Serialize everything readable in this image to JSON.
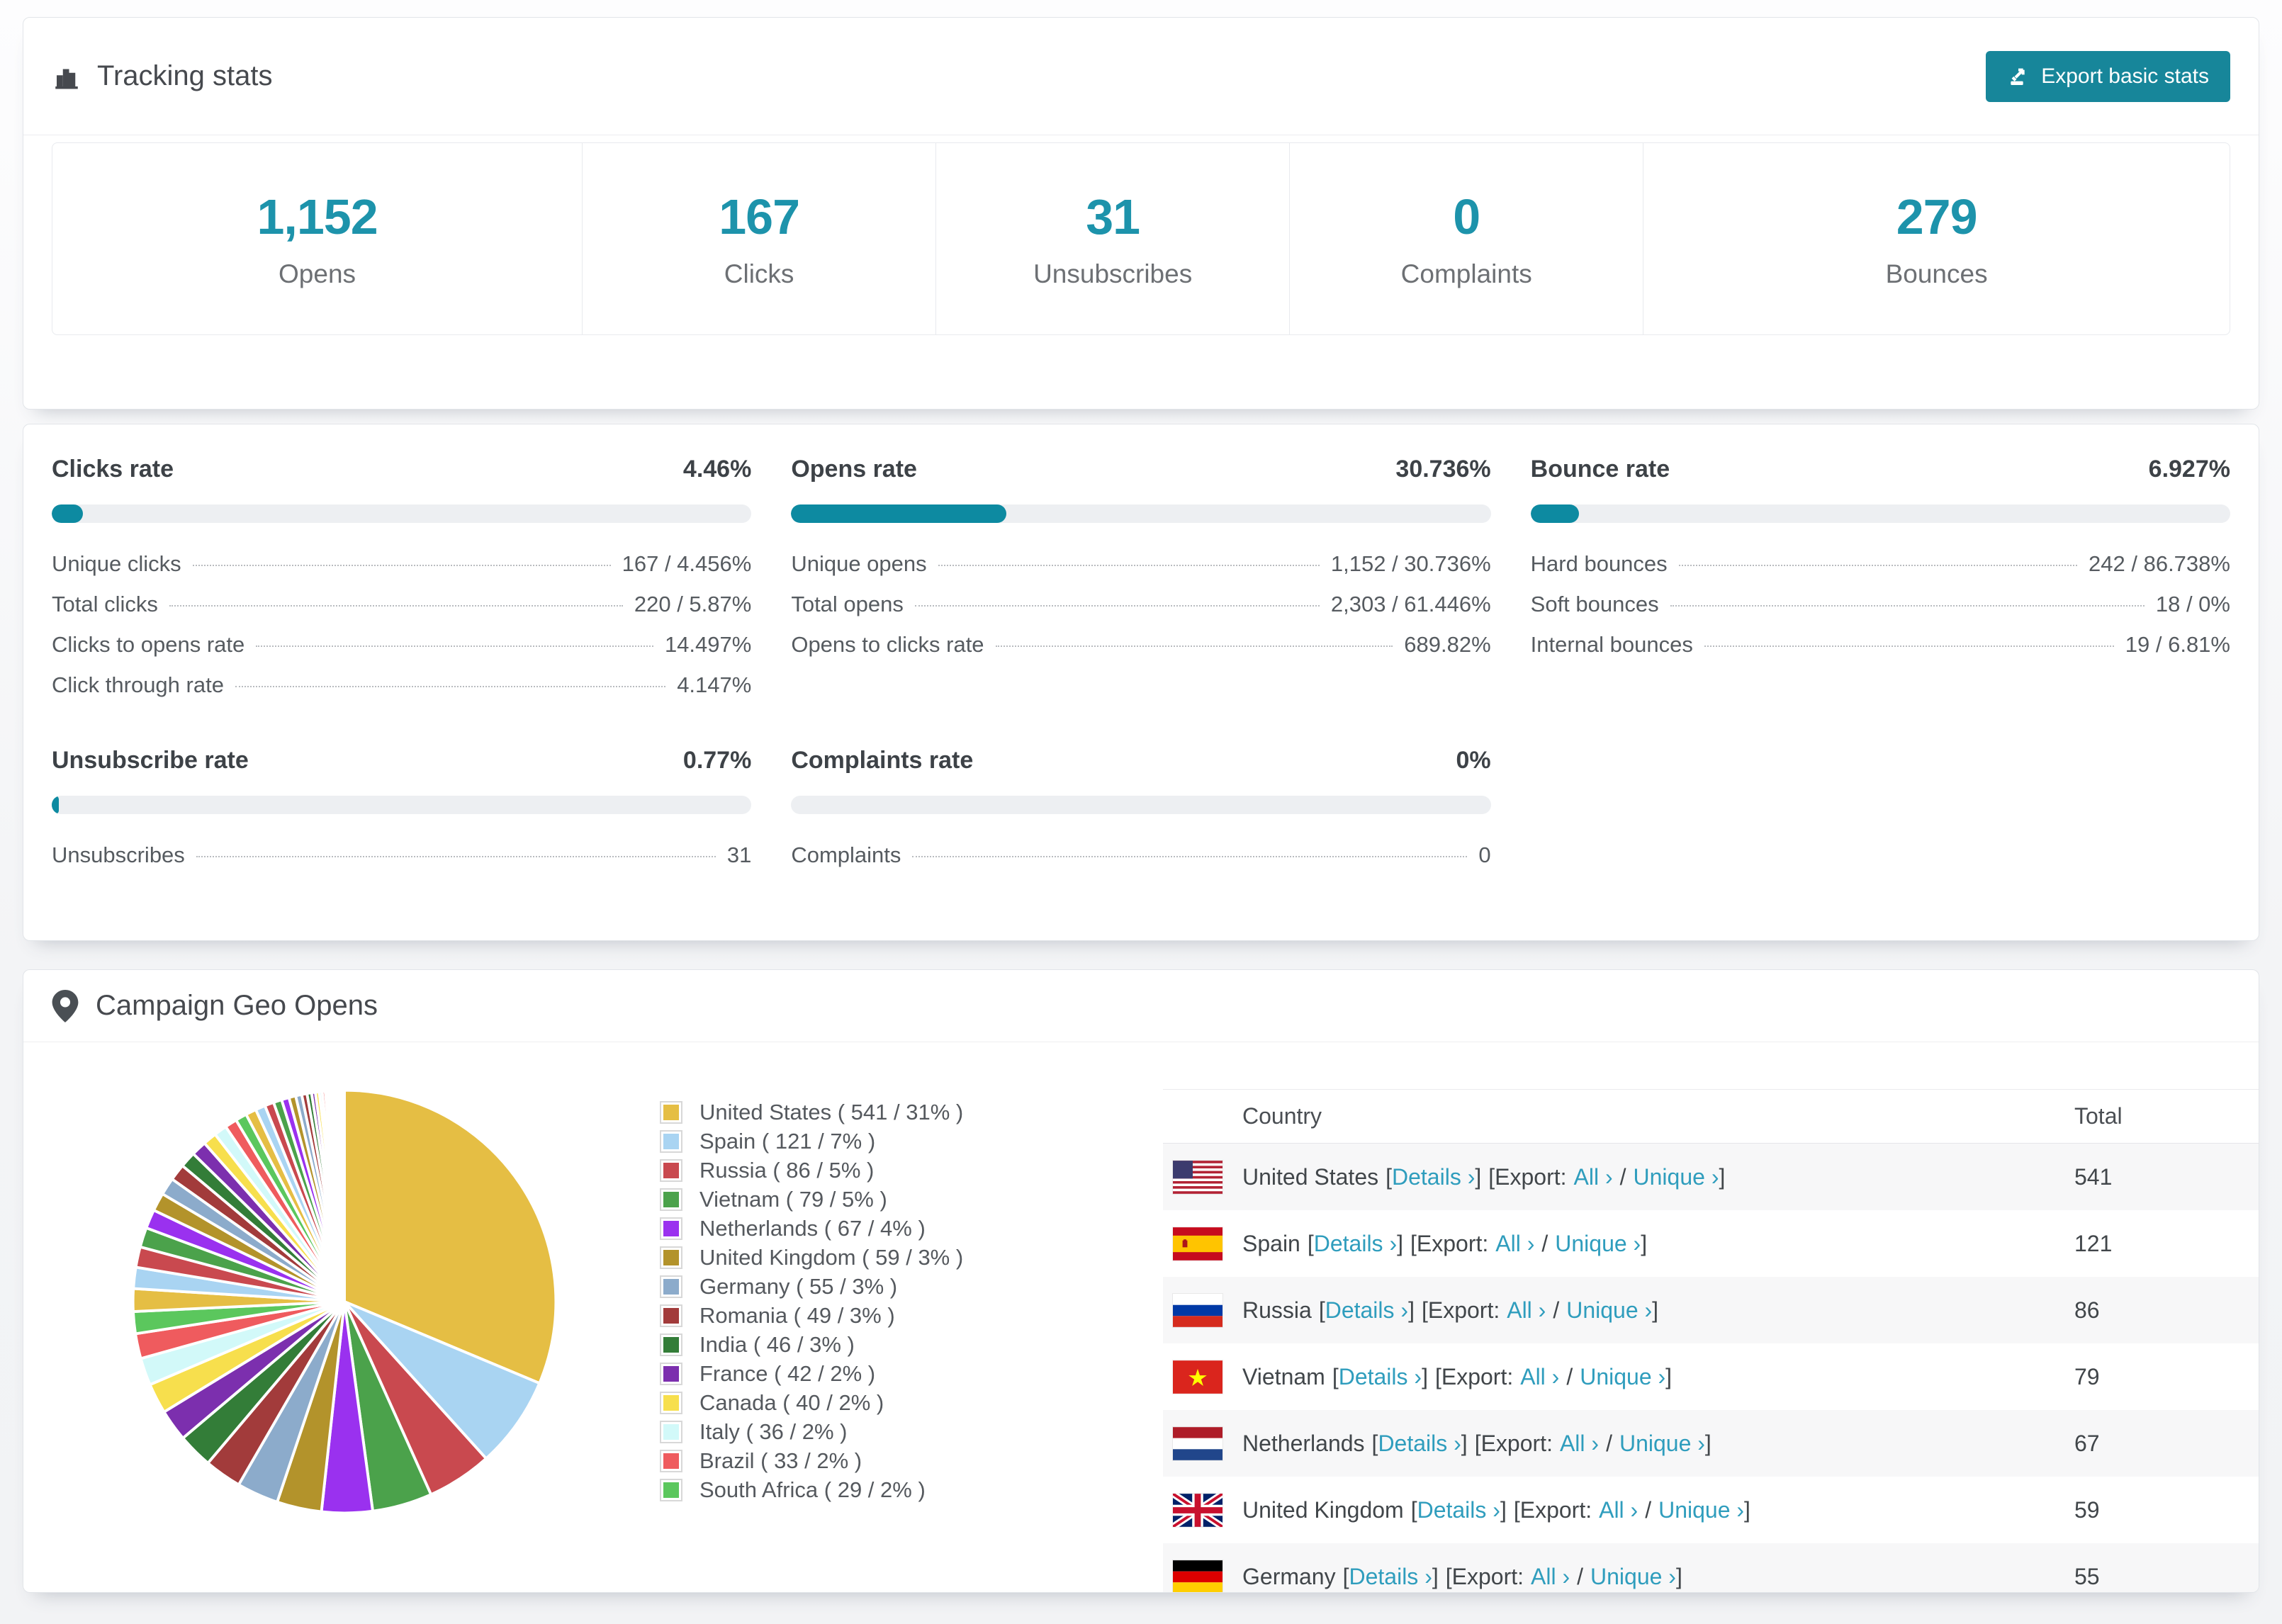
{
  "accent": "#17869a",
  "header": {
    "title": "Tracking stats",
    "export_label": "Export basic stats"
  },
  "summary": [
    {
      "value": "1,152",
      "label": "Opens"
    },
    {
      "value": "167",
      "label": "Clicks"
    },
    {
      "value": "31",
      "label": "Unsubscribes"
    },
    {
      "value": "0",
      "label": "Complaints"
    },
    {
      "value": "279",
      "label": "Bounces"
    }
  ],
  "rates": {
    "clicks": {
      "title": "Clicks rate",
      "value": "4.46%",
      "percent": 4.46,
      "rows": [
        {
          "label": "Unique clicks",
          "value": "167 / 4.456%"
        },
        {
          "label": "Total clicks",
          "value": "220 / 5.87%"
        },
        {
          "label": "Clicks to opens rate",
          "value": "14.497%"
        },
        {
          "label": "Click through rate",
          "value": "4.147%"
        }
      ]
    },
    "opens": {
      "title": "Opens rate",
      "value": "30.736%",
      "percent": 30.736,
      "rows": [
        {
          "label": "Unique opens",
          "value": "1,152 / 30.736%"
        },
        {
          "label": "Total opens",
          "value": "2,303 / 61.446%"
        },
        {
          "label": "Opens to clicks rate",
          "value": "689.82%"
        }
      ]
    },
    "bounce": {
      "title": "Bounce rate",
      "value": "6.927%",
      "percent": 6.927,
      "rows": [
        {
          "label": "Hard bounces",
          "value": "242 / 86.738%"
        },
        {
          "label": "Soft bounces",
          "value": "18 / 0%"
        },
        {
          "label": "Internal bounces",
          "value": "19 / 6.81%"
        }
      ]
    },
    "unsubscribe": {
      "title": "Unsubscribe rate",
      "value": "0.77%",
      "percent": 0.77,
      "rows": [
        {
          "label": "Unsubscribes",
          "value": "31"
        }
      ]
    },
    "complaints": {
      "title": "Complaints rate",
      "value": "0%",
      "percent": 0,
      "rows": [
        {
          "label": "Complaints",
          "value": "0"
        }
      ]
    }
  },
  "geo": {
    "title": "Campaign Geo Opens",
    "fmt": {
      "lb": "[",
      "rb": "]",
      "exp": "[Export:",
      "slash": "/"
    },
    "links": {
      "details": "Details ›",
      "all": "All ›",
      "unique": "Unique ›"
    },
    "table": {
      "headers": {
        "country": "Country",
        "total": "Total"
      },
      "rows": [
        {
          "country": "United States",
          "total": "541"
        },
        {
          "country": "Spain",
          "total": "121"
        },
        {
          "country": "Russia",
          "total": "86"
        },
        {
          "country": "Vietnam",
          "total": "79"
        },
        {
          "country": "Netherlands",
          "total": "67"
        },
        {
          "country": "United Kingdom",
          "total": "59"
        },
        {
          "country": "Germany",
          "total": "55"
        }
      ]
    }
  },
  "chart_data": {
    "type": "pie",
    "title": "Campaign Geo Opens",
    "legend_position": "right-of-pie",
    "slices": [
      {
        "name": "United States",
        "value": 541,
        "pct": 31,
        "color": "#e5be44",
        "legend": "United States ( 541 / 31% )"
      },
      {
        "name": "Spain",
        "value": 121,
        "pct": 7,
        "color": "#a9d4f2",
        "legend": "Spain ( 121 / 7% )"
      },
      {
        "name": "Russia",
        "value": 86,
        "pct": 5,
        "color": "#c9494f",
        "legend": "Russia ( 86 / 5% )"
      },
      {
        "name": "Vietnam",
        "value": 79,
        "pct": 5,
        "color": "#4ba24b",
        "legend": "Vietnam ( 79 / 5% )"
      },
      {
        "name": "Netherlands",
        "value": 67,
        "pct": 4,
        "color": "#9a31ef",
        "legend": "Netherlands ( 67 / 4% )"
      },
      {
        "name": "United Kingdom",
        "value": 59,
        "pct": 3,
        "color": "#b3932b",
        "legend": "United Kingdom ( 59 / 3% )"
      },
      {
        "name": "Germany",
        "value": 55,
        "pct": 3,
        "color": "#8cabcb",
        "legend": "Germany ( 55 / 3% )"
      },
      {
        "name": "Romania",
        "value": 49,
        "pct": 3,
        "color": "#a23b3b",
        "legend": "Romania ( 49 / 3% )"
      },
      {
        "name": "India",
        "value": 46,
        "pct": 3,
        "color": "#337d38",
        "legend": "India ( 46 / 3% )"
      },
      {
        "name": "France",
        "value": 42,
        "pct": 2,
        "color": "#7c2fae",
        "legend": "France ( 42 / 2% )"
      },
      {
        "name": "Canada",
        "value": 40,
        "pct": 2,
        "color": "#f7df4d",
        "legend": "Canada ( 40 / 2% )"
      },
      {
        "name": "Italy",
        "value": 36,
        "pct": 2,
        "color": "#d2f9f9",
        "legend": "Italy ( 36 / 2% )"
      },
      {
        "name": "Brazil",
        "value": 33,
        "pct": 2,
        "color": "#ef5b5e",
        "legend": "Brazil ( 33 / 2% )"
      },
      {
        "name": "South Africa",
        "value": 29,
        "pct": 2,
        "color": "#5bc75d",
        "legend": "South Africa ( 29 / 2% )"
      }
    ],
    "others_values": [
      30,
      28,
      27,
      26,
      25,
      24,
      23,
      22,
      21,
      20,
      18,
      17,
      16,
      15,
      14,
      13,
      12,
      11,
      10,
      9,
      8,
      7,
      6,
      5,
      5,
      4,
      4,
      3,
      3,
      2,
      2,
      2,
      2,
      1,
      1,
      1,
      1,
      1,
      1,
      1,
      1,
      1,
      1,
      1
    ]
  }
}
